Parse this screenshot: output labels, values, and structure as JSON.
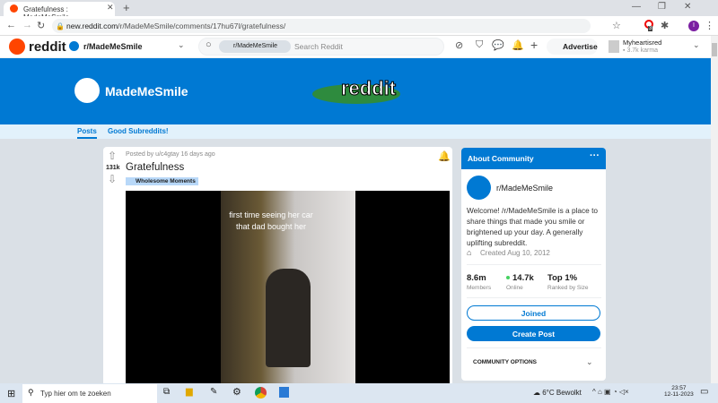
{
  "browser": {
    "tab_title": "Gratefulness : MadeMeSmile",
    "url_host": "new.reddit.com",
    "url_path": "/r/MadeMeSmile/comments/17hu67l/gratefulness/",
    "ext_badge": "3",
    "profile_initial": "I"
  },
  "header": {
    "logo": "reddit",
    "community": "r/MadeMeSmile",
    "search_chip": "r/MadeMeSmile",
    "search_placeholder": "Search Reddit",
    "advertise": "Advertise",
    "username": "Myheartisred",
    "karma": "3.7k karma"
  },
  "banner": {
    "name": "MadeMeSmile",
    "logo_text": "reddit"
  },
  "subnav": {
    "tabs": [
      "Posts",
      "Good Subreddits!"
    ]
  },
  "post": {
    "meta": "Posted by u/c4gtay 16 days ago",
    "votes": "131k",
    "title": "Gratefulness",
    "flair": "Wholesome Moments",
    "caption": "first time seeing her car that dad bought her"
  },
  "about": {
    "header": "About Community",
    "name": "r/MadeMeSmile",
    "description": "Welcome! /r/MadeMeSmile is a place to share things that made you smile or brightened up your day. A generally uplifting subreddit.",
    "created": "Created Aug 10, 2012",
    "stats": [
      {
        "value": "8.6m",
        "label": "Members"
      },
      {
        "value": "14.7k",
        "label": "Online"
      },
      {
        "value": "Top 1%",
        "label": "Ranked by Size"
      }
    ],
    "joined": "Joined",
    "create_post": "Create Post",
    "options": "COMMUNITY OPTIONS"
  },
  "taskbar": {
    "search": "Typ hier om te zoeken",
    "weather": "6°C  Bewolkt",
    "time": "23:57",
    "date": "12-11-2023"
  }
}
